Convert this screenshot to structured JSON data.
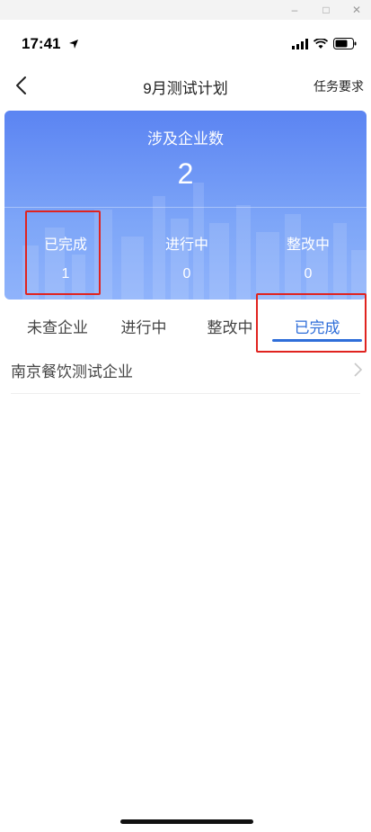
{
  "status_bar": {
    "time": "17:41"
  },
  "nav": {
    "title": "9月测试计划",
    "right_action": "任务要求"
  },
  "summary": {
    "label": "涉及企业数",
    "count": "2",
    "stats": [
      {
        "label": "已完成",
        "value": "1"
      },
      {
        "label": "进行中",
        "value": "0"
      },
      {
        "label": "整改中",
        "value": "0"
      }
    ]
  },
  "tabs": [
    {
      "label": "未查企业"
    },
    {
      "label": "进行中"
    },
    {
      "label": "整改中"
    },
    {
      "label": "已完成"
    }
  ],
  "active_tab": "已完成",
  "list": [
    {
      "name": "南京餐饮测试企业"
    }
  ],
  "colors": {
    "accent": "#2f6ed9",
    "hero": "#6b94f5",
    "highlight": "#e0231f"
  },
  "icons": [
    "location-arrow-icon",
    "signal-icon",
    "wifi-icon",
    "battery-icon",
    "back-chevron-icon",
    "chevron-right-icon",
    "minimize-icon",
    "maximize-icon",
    "close-icon"
  ]
}
